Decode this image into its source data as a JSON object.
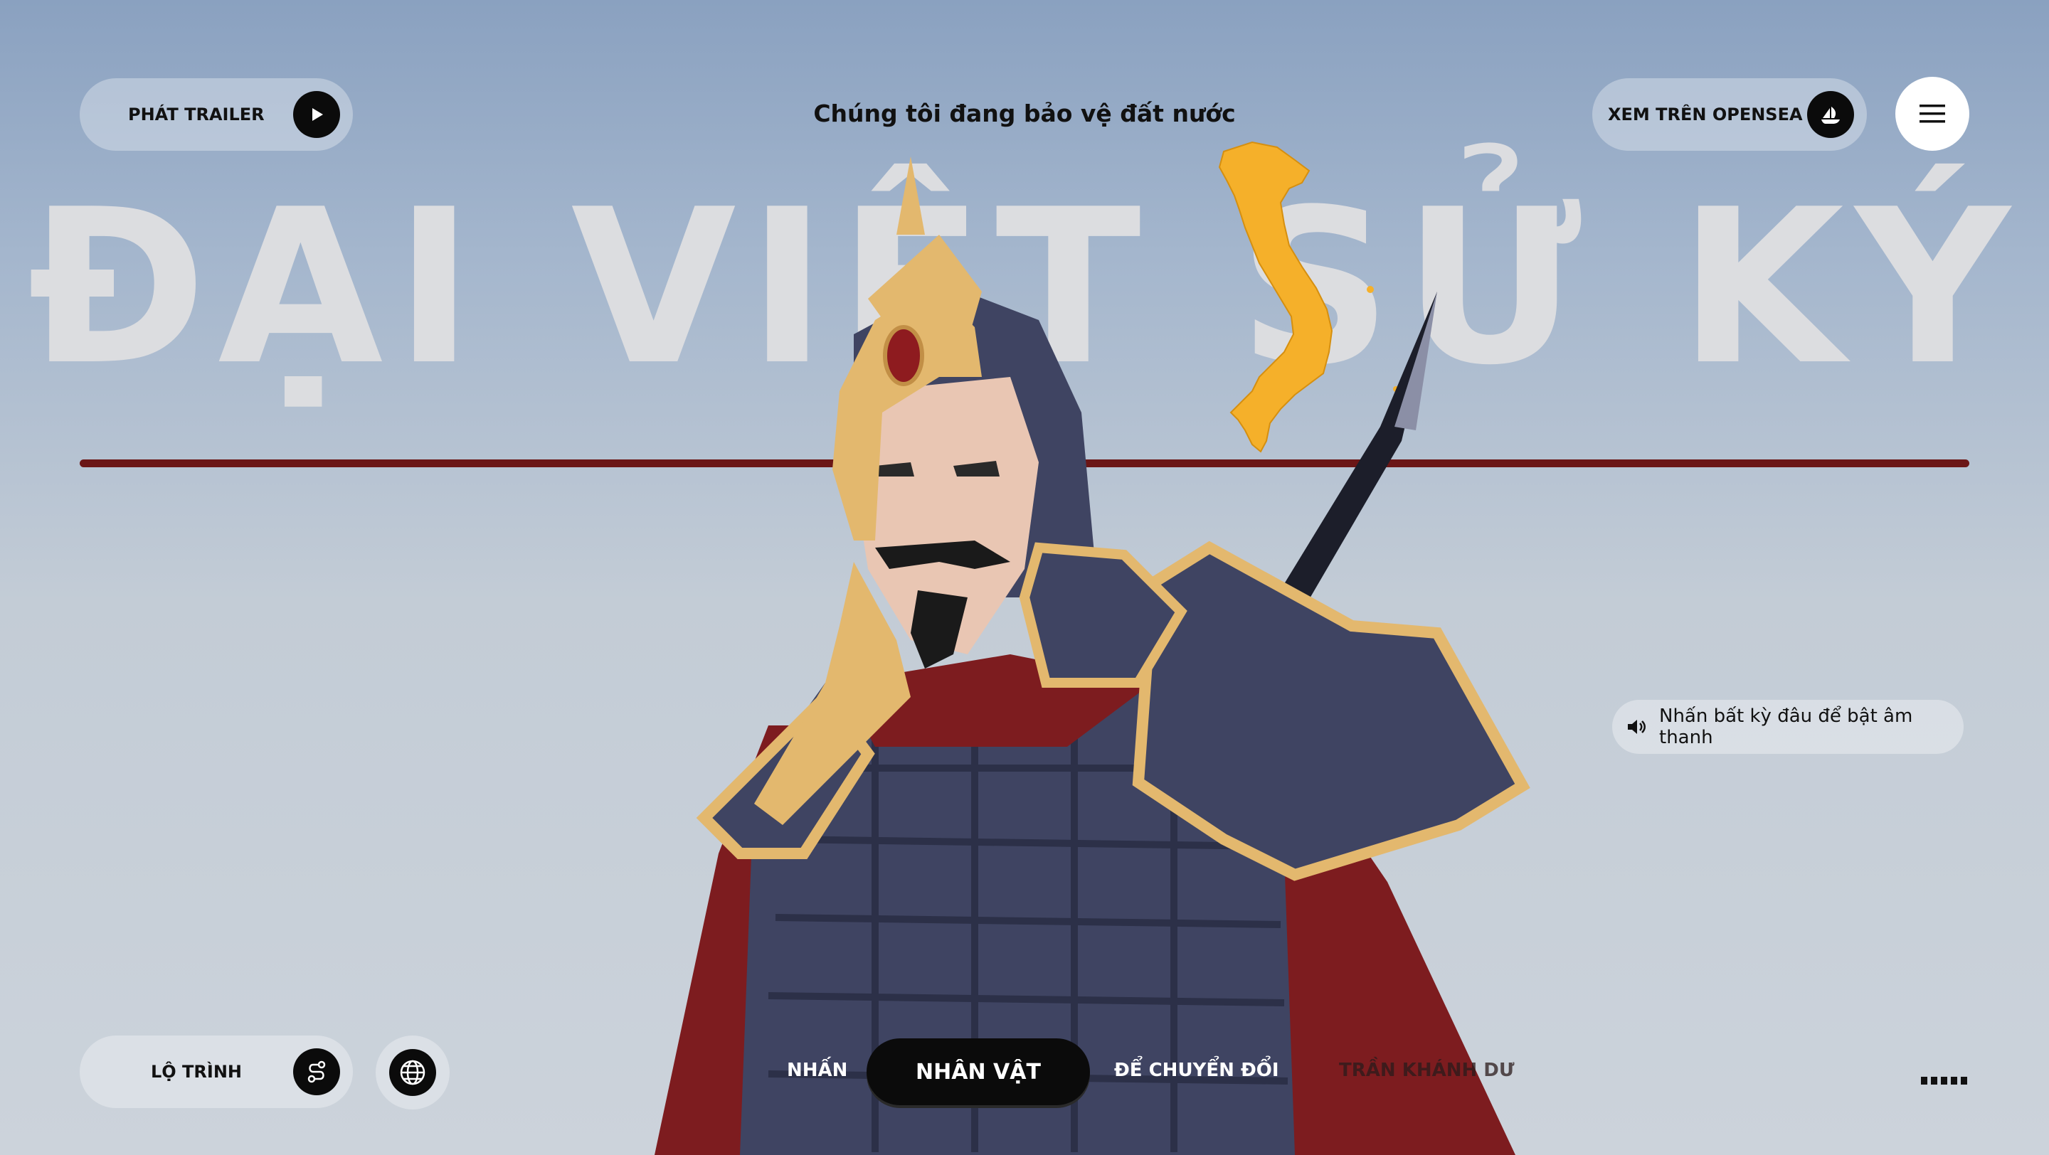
{
  "header": {
    "trailer_label": "PHÁT TRAILER",
    "tagline": "Chúng tôi đang bảo vệ đất nước",
    "opensea_label": "XEM TRÊN OPENSEA"
  },
  "hero": {
    "title": "ĐẠI VIỆT SỬ KÝ"
  },
  "sound_hint": "Nhấn bất kỳ đâu để bật âm thanh",
  "footer": {
    "roadmap_label": "LỘ TRÌNH",
    "nav": {
      "press": "NHẤN",
      "character": "NHÂN VẬT",
      "to_switch": "ĐỂ CHUYỂN ĐỔI",
      "name": "TRẦN KHÁNH DƯ"
    }
  },
  "icons": {
    "play": "play-icon",
    "opensea": "opensea-icon",
    "menu": "hamburger-menu-icon",
    "route": "route-icon",
    "globe": "globe-icon",
    "speaker": "speaker-icon",
    "more": "more-dots-icon"
  },
  "colors": {
    "accent_dark": "#0b0b0b",
    "divider": "#6b1616",
    "map": "#f5b02a"
  }
}
